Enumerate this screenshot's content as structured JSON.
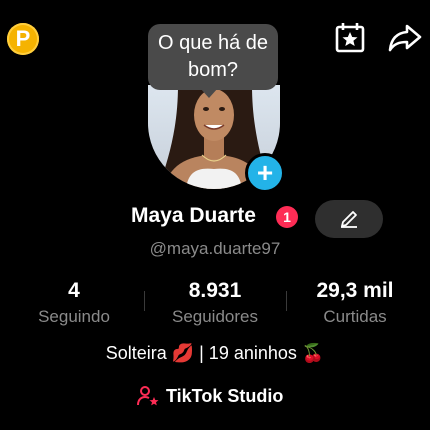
{
  "header": {
    "coin_icon": "coin-p-icon",
    "coin_letter": "P",
    "calendar_icon": "calendar-star-icon",
    "share_icon": "share-arrow-icon"
  },
  "tooltip": {
    "line1": "O que há de",
    "line2": "bom?"
  },
  "profile": {
    "name": "Maya Duarte",
    "notification_count": "1",
    "handle": "@maya.duarte97",
    "add_icon": "plus-icon",
    "edit_icon": "pencil-icon"
  },
  "stats": [
    {
      "value": "4",
      "label": "Seguindo"
    },
    {
      "value": "8.931",
      "label": "Seguidores"
    },
    {
      "value": "29,3 mil",
      "label": "Curtidas"
    }
  ],
  "bio": "Solteira 💋 | 19 aninhos 🍒",
  "studio": {
    "label": "TikTok Studio",
    "icon": "person-star-icon"
  },
  "colors": {
    "background": "#000000",
    "accent_red": "#fe2c55",
    "accent_blue": "#23b3e8",
    "coin": "#f5b301",
    "muted_text": "#8a8a8a"
  }
}
